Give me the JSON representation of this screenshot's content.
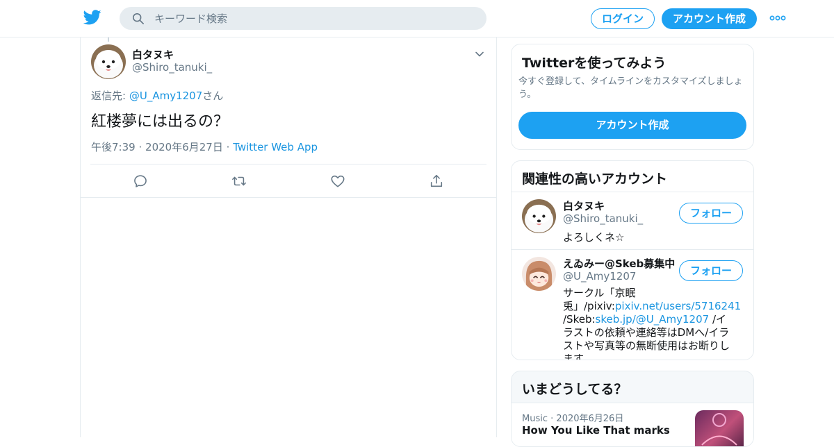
{
  "header": {
    "logo_icon": "twitter-bird-icon",
    "search_placeholder": "キーワード検索",
    "login_label": "ログイン",
    "signup_label": "アカウント作成",
    "more_icon": "more-dots-icon"
  },
  "tweet": {
    "author_name": "白タヌキ",
    "author_handle": "@Shiro_tanuki_",
    "reply_prefix": "返信先:",
    "reply_to": "@U_Amy1207",
    "reply_suffix": "さん",
    "text": "紅楼夢には出るの？",
    "time": "午後7:39",
    "date": "2020年6月27日",
    "source": "Twitter Web App",
    "separator": "·",
    "actions": [
      "reply-icon",
      "retweet-icon",
      "like-icon",
      "share-icon"
    ]
  },
  "signup_card": {
    "title": "Twitterを使ってみよう",
    "description": "今すぐ登録して、タイムラインをカスタマイズしましょう。",
    "button_label": "アカウント作成"
  },
  "related": {
    "title": "関連性の高いアカウント",
    "accounts": [
      {
        "name": "白タヌキ",
        "handle": "@Shiro_tanuki_",
        "follow_label": "フォロー",
        "bio": "よろしくネ☆"
      },
      {
        "name": "えゐみー@Skeb募集中",
        "handle": "@U_Amy1207",
        "follow_label": "フォロー",
        "bio_1": "サークル「京眠兎」/pixiv:",
        "bio_link_1": "pixiv.net/users/5716241",
        "bio_2": " /Skeb:",
        "bio_link_2": "skeb.jp/@U_Amy1207",
        "bio_3": " /イラストの依頼や連絡等はDMへ/イラストや写真等の無断使用はお断りします"
      }
    ]
  },
  "trends": {
    "title": "いまどうしてる？",
    "items": [
      {
        "category": "Music",
        "separator": "·",
        "date": "2020年6月26日",
        "headline": "How You Like That marks"
      }
    ]
  },
  "colors": {
    "accent": "#1da1f2",
    "link": "#1b95e0",
    "secondary_text": "#657786",
    "border": "#e6ecf0"
  }
}
